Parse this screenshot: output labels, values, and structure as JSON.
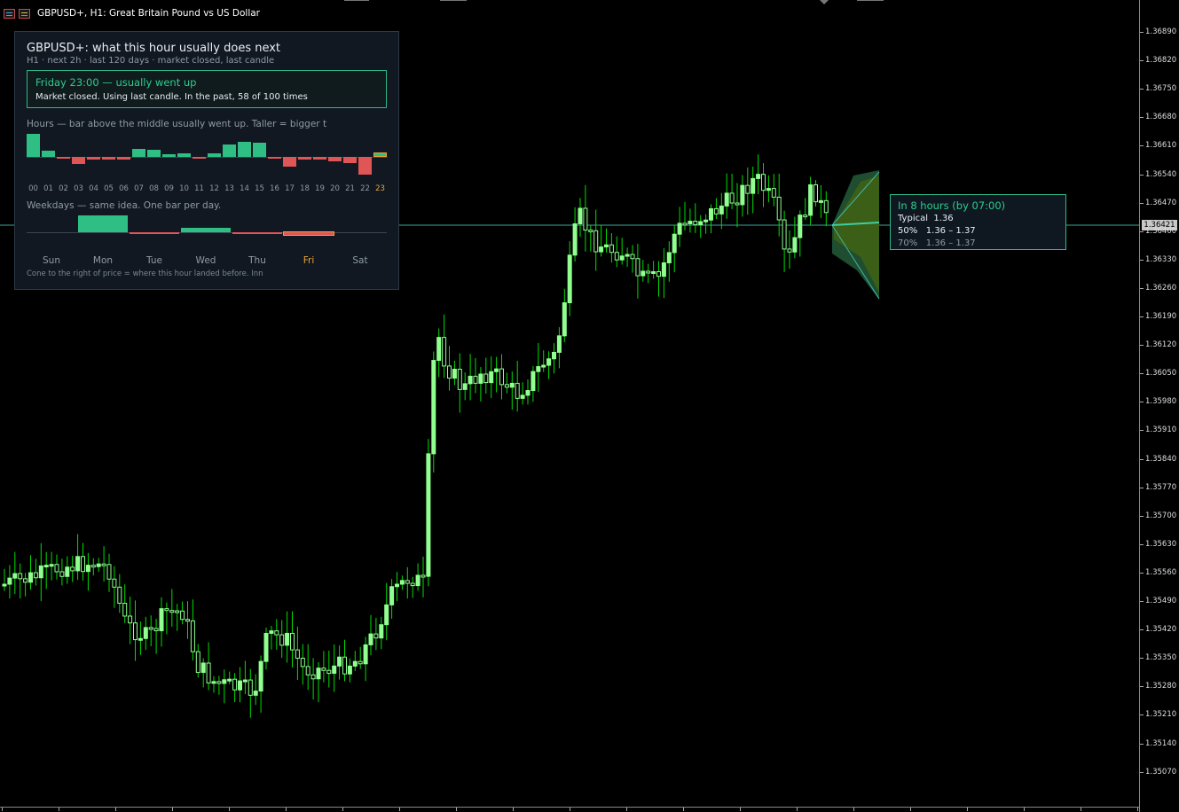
{
  "window": {
    "title": "GBPUSD+, H1:  Great Britain Pound vs US Dollar",
    "icons": [
      "chart-window-icon",
      "symbol-window-icon"
    ]
  },
  "colors": {
    "background": "#000000",
    "bull_candle": "#90ff90",
    "wick": "#00dd00",
    "up": "#2fbf85",
    "down": "#e05555",
    "highlight": "#e8a53a",
    "cone_outer": "#1e4d30",
    "cone_inner": "#3b5f17",
    "price_line": "#3aa7a0"
  },
  "price_axis": {
    "labels": [
      "1.36890",
      "1.36820",
      "1.36750",
      "1.36680",
      "1.36610",
      "1.36540",
      "1.36470",
      "1.36400",
      "1.36330",
      "1.36260",
      "1.36190",
      "1.36120",
      "1.36050",
      "1.35980",
      "1.35910",
      "1.35840",
      "1.35770",
      "1.35700",
      "1.35630",
      "1.35560",
      "1.35490",
      "1.35420",
      "1.35350",
      "1.35280",
      "1.35210",
      "1.35140",
      "1.35070"
    ],
    "current": "1.36421"
  },
  "panel": {
    "title": "GBPUSD+: what this hour usually does next",
    "subtitle": "H1  ·  next 2h  ·  last 120 days  ·  market closed, last candle",
    "highlight_head": "Friday 23:00 — usually went up",
    "highlight_body": "Market closed. Using last candle.  In the past, 58 of 100 times",
    "hours_caption": "Hours — bar above the middle usually went up. Taller = bigger t",
    "hours_labels": [
      "00",
      "01",
      "02",
      "03",
      "04",
      "05",
      "06",
      "07",
      "08",
      "09",
      "10",
      "11",
      "12",
      "13",
      "14",
      "15",
      "16",
      "17",
      "18",
      "19",
      "20",
      "21",
      "22",
      "23"
    ],
    "hours_values": [
      1.0,
      0.28,
      -0.08,
      -0.32,
      -0.12,
      -0.1,
      -0.1,
      0.36,
      0.3,
      0.1,
      0.14,
      -0.08,
      0.16,
      0.52,
      0.66,
      0.62,
      -0.06,
      -0.42,
      -0.1,
      -0.12,
      -0.18,
      -0.28,
      -0.78,
      0.16
    ],
    "hours_selected": 23,
    "weekdays_caption": "Weekdays — same idea. One bar per day.",
    "weekday_labels": [
      "Sun",
      "Mon",
      "Tue",
      "Wed",
      "Thu",
      "Fri",
      "Sat"
    ],
    "weekday_values": [
      0,
      1.0,
      -0.1,
      0.24,
      -0.1,
      -0.14,
      0
    ],
    "weekday_selected": 5,
    "footer": "Cone to the right of price = where this hour landed before. Inn"
  },
  "forecast": {
    "head": "In 8 hours  (by 07:00)",
    "typical_label": "Typical",
    "typical_value": "1.36",
    "p50_label": "50%",
    "p50_range": "1.36 – 1.37",
    "p70_label": "70%",
    "p70_range": "1.36 – 1.37"
  }
}
